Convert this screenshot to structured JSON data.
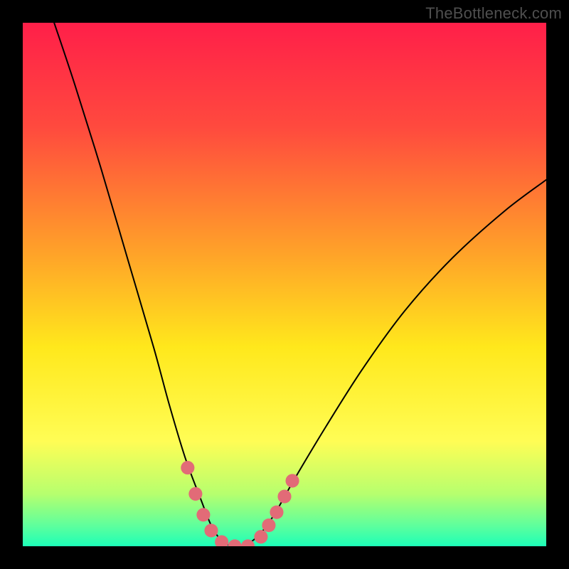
{
  "watermark": "TheBottleneck.com",
  "chart_data": {
    "type": "line",
    "title": "",
    "xlabel": "",
    "ylabel": "",
    "xlim": [
      0,
      100
    ],
    "ylim": [
      0,
      100
    ],
    "grid": false,
    "legend": false,
    "background_gradient": {
      "stops": [
        {
          "offset": 0.0,
          "color": "#ff1f49"
        },
        {
          "offset": 0.2,
          "color": "#ff4a3e"
        },
        {
          "offset": 0.45,
          "color": "#ffa628"
        },
        {
          "offset": 0.62,
          "color": "#ffe81c"
        },
        {
          "offset": 0.8,
          "color": "#fffd55"
        },
        {
          "offset": 0.9,
          "color": "#b6ff6e"
        },
        {
          "offset": 0.96,
          "color": "#5fff9c"
        },
        {
          "offset": 1.0,
          "color": "#1dffb7"
        }
      ]
    },
    "series": [
      {
        "name": "bottleneck-curve",
        "color": "#000000",
        "x": [
          6,
          10,
          15,
          20,
          25,
          28,
          31,
          34,
          36,
          38,
          40,
          42,
          45,
          48,
          52,
          58,
          65,
          73,
          82,
          92,
          100
        ],
        "y": [
          100,
          88,
          72,
          55,
          38,
          27,
          17,
          9,
          4,
          1,
          0,
          0,
          2,
          6,
          13,
          23,
          34,
          45,
          55,
          64,
          70
        ]
      }
    ],
    "markers": {
      "name": "trough-markers",
      "color": "#e26b77",
      "radius_pct": 1.3,
      "points": [
        {
          "x": 31.5,
          "y": 15
        },
        {
          "x": 33.0,
          "y": 10
        },
        {
          "x": 34.5,
          "y": 6
        },
        {
          "x": 36.0,
          "y": 3
        },
        {
          "x": 38.0,
          "y": 0.8
        },
        {
          "x": 40.5,
          "y": 0
        },
        {
          "x": 43.0,
          "y": 0
        },
        {
          "x": 45.5,
          "y": 1.8
        },
        {
          "x": 47.0,
          "y": 4
        },
        {
          "x": 48.5,
          "y": 6.5
        },
        {
          "x": 50.0,
          "y": 9.5
        },
        {
          "x": 51.5,
          "y": 12.5
        }
      ]
    }
  }
}
